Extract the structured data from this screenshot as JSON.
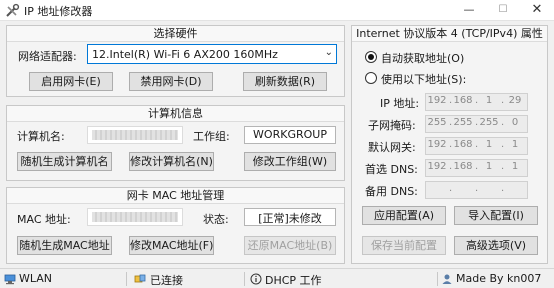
{
  "window": {
    "title": "IP 地址修改器",
    "minimize": "—",
    "maximize": "☐",
    "close": "✕"
  },
  "hardware": {
    "title": "选择硬件",
    "adapter_label": "网络适配器:",
    "adapter_value": "12.Intel(R) Wi-Fi 6 AX200 160MHz",
    "enable_button": "启用网卡(E)",
    "disable_button": "禁用网卡(D)",
    "refresh_button": "刷新数据(R)"
  },
  "computer": {
    "title": "计算机信息",
    "name_label": "计算机名:",
    "workgroup_label": "工作组:",
    "workgroup_value": "WORKGROUP",
    "random_name_button": "随机生成计算机名",
    "modify_name_button": "修改计算机名(N)",
    "modify_workgroup_button": "修改工作组(W)"
  },
  "mac": {
    "title": "网卡 MAC 地址管理",
    "address_label": "MAC 地址:",
    "status_label": "状态:",
    "status_value": "[正常]未修改",
    "random_button": "随机生成MAC地址",
    "modify_button": "修改MAC地址(F)",
    "restore_button": "还原MAC地址(B)"
  },
  "ipv4": {
    "title": "Internet 协议版本 4 (TCP/IPv4) 属性",
    "auto_radio": "自动获取地址(O)",
    "manual_radio": "使用以下地址(S):",
    "ip_label": "IP 地址:",
    "mask_label": "子网掩码:",
    "gateway_label": "默认网关:",
    "preferred_dns_label": "首选 DNS:",
    "alternate_dns_label": "备用 DNS:",
    "ip": [
      "192",
      "168",
      "1",
      "29"
    ],
    "mask": [
      "255",
      "255",
      "255",
      "0"
    ],
    "gateway": [
      "192",
      "168",
      "1",
      "1"
    ],
    "preferred_dns": [
      "192",
      "168",
      "1",
      "1"
    ],
    "apply_button": "应用配置(A)",
    "import_button": "导入配置(I)",
    "save_button": "保存当前配置",
    "advanced_button": "高级选项(V)"
  },
  "statusbar": {
    "connection": "WLAN",
    "state": "已连接",
    "dhcp": "DHCP 工作",
    "author": "Made By kn007"
  }
}
